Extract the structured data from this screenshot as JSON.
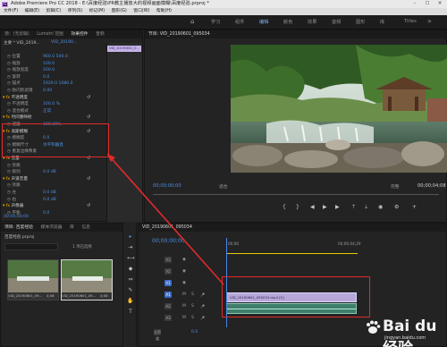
{
  "window": {
    "title": "Adobe Premiere Pro CC 2018 - E:\\百度经验\\PR教主播放大的视频画面模糊\\百度经验.prproj *",
    "logo": "Pr"
  },
  "menu": [
    "文件(F)",
    "编辑(E)",
    "剪辑(C)",
    "序列(S)",
    "标记(M)",
    "图形(G)",
    "窗口(W)",
    "帮助(H)"
  ],
  "workspaces": {
    "items": [
      "学习",
      "组件",
      "编辑",
      "颜色",
      "效果",
      "音频",
      "图形",
      "库",
      "Titles"
    ],
    "active": "编辑"
  },
  "effect_controls": {
    "tabs": [
      "源：(无剪辑)",
      "Lumetri 范围",
      "效果控件",
      "音频"
    ],
    "active_tab": "效果控件",
    "header_source": "主要 * VID_2019...",
    "header_clip": "VID_20190...",
    "clip_label": "VID_2019061...",
    "rows": [
      {
        "label": "位置",
        "value": "960.0   540.0"
      },
      {
        "label": "缩放",
        "value": "100.0"
      },
      {
        "label": "缩放宽度",
        "value": "100.0"
      },
      {
        "label": "旋转",
        "value": "0.0"
      },
      {
        "label": "锚点",
        "value": "1920.0   1080.0"
      },
      {
        "label": "防闪烁滤镜",
        "value": "0.00"
      },
      {
        "section": "不透明度"
      },
      {
        "label": "不透明度",
        "value": "100.0 %"
      },
      {
        "label": "混合模式",
        "value": "正常"
      },
      {
        "section": "时间重映射"
      },
      {
        "label": "速度",
        "value": "100.00%"
      },
      {
        "section": "高斯模糊"
      },
      {
        "label": "模糊度",
        "value": "0.0"
      },
      {
        "label": "模糊尺寸",
        "value": "水平和垂直"
      },
      {
        "label": "重复边缘像素",
        "value": ""
      },
      {
        "section": "音量"
      },
      {
        "label": "旁路",
        "value": ""
      },
      {
        "label": "级别",
        "value": "0.0 dB"
      },
      {
        "section": "声道音量"
      },
      {
        "label": "旁路",
        "value": ""
      },
      {
        "label": "左",
        "value": "0.0 dB"
      },
      {
        "label": "右",
        "value": "0.0 dB"
      },
      {
        "section": "声像器"
      },
      {
        "label": "平衡",
        "value": "0.0"
      }
    ],
    "mini_clip": "VID_20190601_0...",
    "timecode": "00;00;00;00"
  },
  "program_monitor": {
    "title": "节目: VID_20190601_095034",
    "timecode": "00;00;00;00",
    "fit": "适合",
    "quality": "完整",
    "duration": "00;00;04;08"
  },
  "project": {
    "tabs": [
      "项目: 百度经验",
      "媒体浏览器",
      "库",
      "信息"
    ],
    "active_tab": "项目: 百度经验",
    "project_file": "百度经验.prproj",
    "item_count": "1 项已选择",
    "clips": [
      {
        "name": "VID_20190601_09...",
        "duration": "4;08"
      },
      {
        "name": "VID_20190601_09...",
        "duration": "4;08"
      }
    ]
  },
  "timeline": {
    "sequence_tab": "VID_20190601_095034",
    "timecode": "00;00;00;00",
    "ruler": [
      "00;00",
      "00;00;04;29"
    ],
    "tracks": [
      "V3",
      "V2",
      "V1",
      "A1",
      "A2",
      "A3",
      "主声道"
    ],
    "master_value": "0.0",
    "video_clip": "VID_20190601_095034.mp4 [V]",
    "audio_clip": ""
  },
  "watermark": {
    "text": "Bai du 经验",
    "sub": "jingyan.baidu.com"
  },
  "colors": {
    "accent_blue": "#4b8fe0",
    "highlight_red": "#e12a2a",
    "clip_purple": "#b7a7d9",
    "clip_green": "#3e7f6c"
  }
}
